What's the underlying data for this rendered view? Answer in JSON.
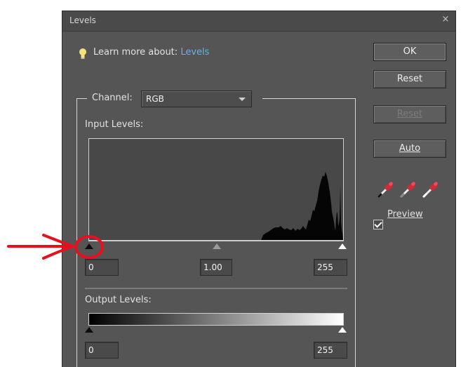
{
  "dialog": {
    "title": "Levels",
    "close_glyph": "×",
    "learn_more_prefix": "Learn more about:",
    "learn_more_link": "Levels"
  },
  "buttons": {
    "ok": "OK",
    "reset": "Reset",
    "reset_disabled": "Reset",
    "auto": "Auto"
  },
  "channel": {
    "label": "Channel:",
    "selected": "RGB"
  },
  "input_levels": {
    "label": "Input Levels:",
    "black": "0",
    "gamma": "1.00",
    "white": "255"
  },
  "output_levels": {
    "label": "Output Levels:",
    "black": "0",
    "white": "255"
  },
  "preview": {
    "label": "Preview",
    "checked": true
  },
  "icons": [
    "lightbulb-icon",
    "black-eyedropper-icon",
    "gray-eyedropper-icon",
    "white-eyedropper-icon",
    "close-icon",
    "dropdown-arrow-icon"
  ],
  "colors": {
    "dialog_bg": "#555555",
    "link": "#5cb6ec",
    "annotation": "#e8101e"
  }
}
